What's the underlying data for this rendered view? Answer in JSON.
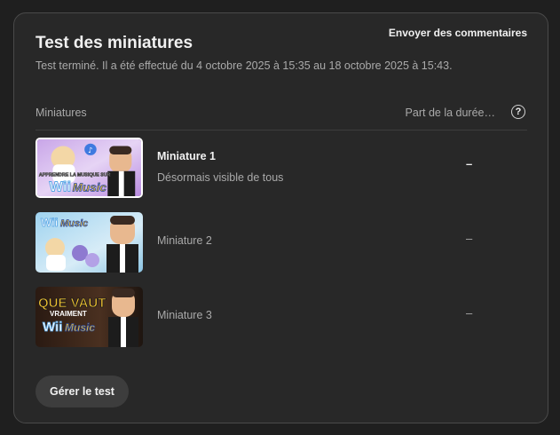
{
  "card": {
    "title": "Test des miniatures",
    "feedback_label": "Envoyer des commentaires",
    "subtitle": "Test terminé. Il a été effectué du 4 octobre 2025 à 15:35 au 18 octobre 2025 à 15:43."
  },
  "table": {
    "col_thumbnails": "Miniatures",
    "col_share": "Part de la durée…",
    "help_icon": "?",
    "rows": [
      {
        "name": "Miniature 1",
        "status": "Désormais visible de tous",
        "value": "–",
        "thumb_text_top": "APPRENDRE LA MUSIQUE SUR",
        "thumb_logo_a": "Wii",
        "thumb_logo_b": "Music"
      },
      {
        "name": "Miniature 2",
        "value": "–",
        "thumb_logo_a": "Wii",
        "thumb_logo_b": "Music"
      },
      {
        "name": "Miniature 3",
        "value": "–",
        "thumb_text_top": "QUE VAUT",
        "thumb_text_mid": "VRAIMENT",
        "thumb_logo_a": "Wii",
        "thumb_logo_b": "Music"
      }
    ]
  },
  "actions": {
    "manage_label": "Gérer le test"
  },
  "colors": {
    "background": "#1f1f1f",
    "card": "#282828",
    "button": "#3d3d3d",
    "muted_text": "#aaaaaa",
    "logo_blue": "#5aa7e6",
    "logo_yellow": "#f2c230"
  }
}
